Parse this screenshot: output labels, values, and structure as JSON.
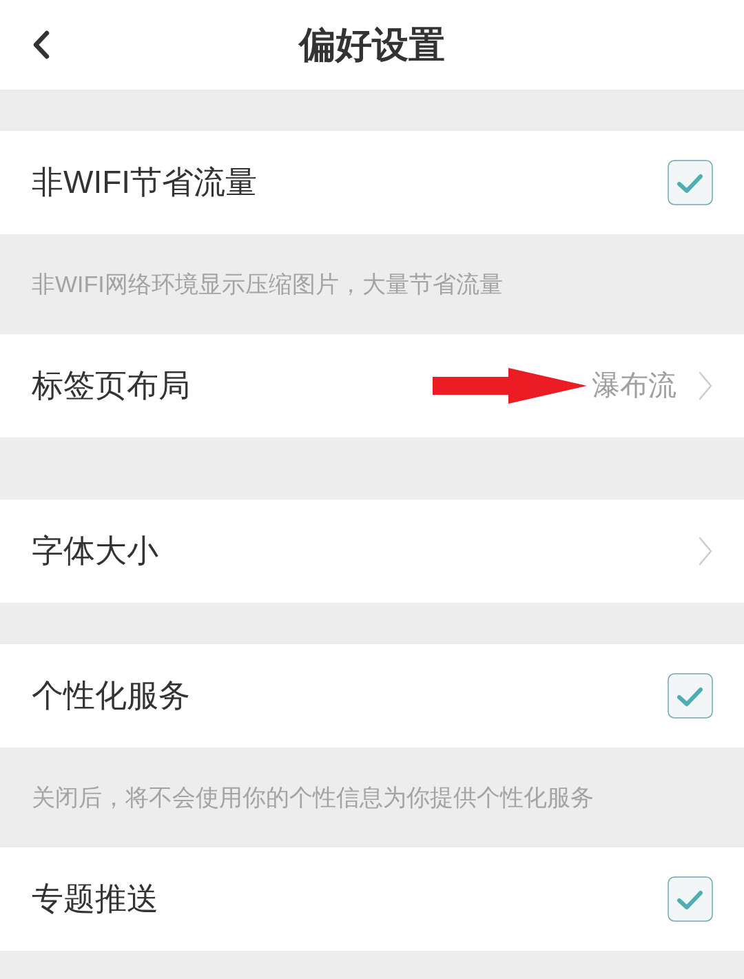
{
  "header": {
    "title": "偏好设置"
  },
  "items": [
    {
      "kind": "checkbox",
      "label": "非WIFI节省流量",
      "checked": true,
      "highlight_arrow": false
    },
    {
      "kind": "note",
      "text": "非WIFI网络环境显示压缩图片，大量节省流量"
    },
    {
      "kind": "link",
      "label": "标签页布局",
      "value": "瀑布流",
      "highlight_arrow": true
    },
    {
      "kind": "link",
      "label": "字体大小",
      "highlight_arrow": false
    },
    {
      "kind": "checkbox",
      "label": "个性化服务",
      "checked": true,
      "highlight_arrow": false
    },
    {
      "kind": "note",
      "text": "关闭后，将不会使用你的个性信息为你提供个性化服务"
    },
    {
      "kind": "checkbox",
      "label": "专题推送",
      "checked": true,
      "highlight_arrow": false
    }
  ]
}
